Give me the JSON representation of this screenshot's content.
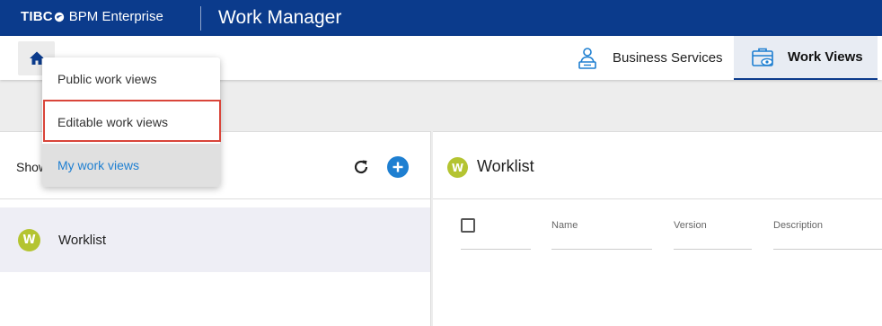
{
  "header": {
    "brand_word": "TIBC",
    "brand_product": "BPM Enterprise",
    "app_title": "Work Manager"
  },
  "nav": {
    "tabs": [
      {
        "label": "Business Services",
        "icon": "person-screen-icon"
      },
      {
        "label": "Work Views",
        "icon": "briefcase-eye-icon",
        "active": true
      }
    ]
  },
  "dropdown": {
    "items": [
      {
        "label": "Public work views"
      },
      {
        "label": "Editable work views",
        "highlighted": true
      },
      {
        "label": "My work views",
        "selected": true
      }
    ]
  },
  "left_panel": {
    "show_label": "Show",
    "items": [
      {
        "badge": "W",
        "label": "Worklist"
      }
    ]
  },
  "right_panel": {
    "badge": "W",
    "title": "Worklist",
    "columns": [
      "Name",
      "Version",
      "Description"
    ]
  },
  "colors": {
    "header_bg": "#0b3b8c",
    "accent": "#1e7fd1",
    "badge": "#b4c431",
    "highlight": "#d9453a"
  }
}
